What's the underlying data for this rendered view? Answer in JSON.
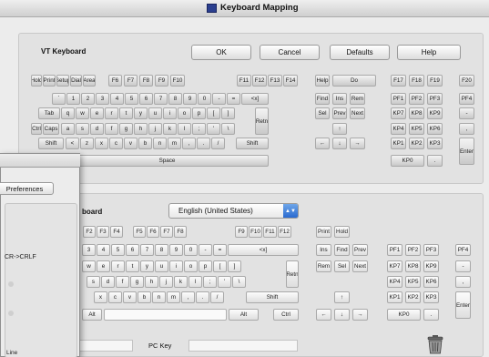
{
  "window": {
    "title": "Keyboard Mapping"
  },
  "top_section": {
    "label": "VT Keyboard",
    "buttons": {
      "ok": "OK",
      "cancel": "Cancel",
      "defaults": "Defaults",
      "help": "Help"
    }
  },
  "vt_keys": {
    "row1": [
      "Hold",
      "Print",
      "Setup",
      "Dial",
      "Area",
      "F6",
      "F7",
      "F8",
      "F9",
      "F10",
      "F11",
      "F12",
      "F13",
      "F14",
      "Help",
      "Do",
      "F17",
      "F18",
      "F19",
      "F20"
    ],
    "row2": [
      "`",
      "1",
      "2",
      "3",
      "4",
      "5",
      "6",
      "7",
      "8",
      "9",
      "0",
      "-",
      "=",
      "<x]",
      "Find",
      "Ins",
      "Rem",
      "PF1",
      "PF2",
      "PF3",
      "PF4"
    ],
    "row3": [
      "Tab",
      "q",
      "w",
      "e",
      "r",
      "t",
      "y",
      "u",
      "i",
      "o",
      "p",
      "[",
      "]",
      "Retn",
      "Sel",
      "Prev",
      "Next",
      "KP7",
      "KP8",
      "KP9",
      "-"
    ],
    "row4": [
      "Ctrl",
      "Caps",
      "a",
      "s",
      "d",
      "f",
      "g",
      "h",
      "j",
      "k",
      "l",
      ";",
      "'",
      "\\",
      "↑",
      "KP4",
      "KP5",
      "KP6",
      ","
    ],
    "row5": [
      "Shift",
      "<",
      "z",
      "x",
      "c",
      "v",
      "b",
      "n",
      "m",
      ",",
      ".",
      "/",
      "Shift",
      "←",
      "↓",
      "→",
      "KP1",
      "KP2",
      "KP3",
      "Enter"
    ],
    "row6": [
      "Space",
      "KP0",
      "."
    ]
  },
  "bottom_section": {
    "label": "board",
    "language": "English (United States)",
    "pc_key_label": "PC Key"
  },
  "pc_keys": {
    "row1": [
      "F2",
      "F3",
      "F4",
      "F5",
      "F6",
      "F7",
      "F8",
      "F9",
      "F10",
      "F11",
      "F12",
      "Print",
      "Hold"
    ],
    "row2": [
      "3",
      "4",
      "5",
      "6",
      "7",
      "8",
      "9",
      "0",
      "-",
      "=",
      "<x]",
      "Ins",
      "Find",
      "Prev",
      "PF1",
      "PF2",
      "PF3",
      "PF4"
    ],
    "row3": [
      "w",
      "e",
      "r",
      "t",
      "y",
      "u",
      "i",
      "o",
      "p",
      "[",
      "]",
      "Retn",
      "Rem",
      "Sel",
      "Next",
      "KP7",
      "KP8",
      "KP9",
      "-"
    ],
    "row4": [
      "s",
      "d",
      "f",
      "g",
      "h",
      "j",
      "k",
      "l",
      ";",
      "'",
      "\\",
      "KP4",
      "KP5",
      "KP6",
      ","
    ],
    "row5": [
      "x",
      "c",
      "v",
      "b",
      "n",
      "m",
      ",",
      ".",
      "/",
      "Shift",
      "↑",
      "KP1",
      "KP2",
      "KP3",
      "Enter"
    ],
    "row6": [
      "Alt",
      "Alt",
      "Ctrl",
      "←",
      "↓",
      "→",
      "KP0",
      "."
    ]
  },
  "prefs_panel": {
    "tab": "Preferences",
    "items": [
      "CR->CRLF",
      "Line"
    ]
  }
}
